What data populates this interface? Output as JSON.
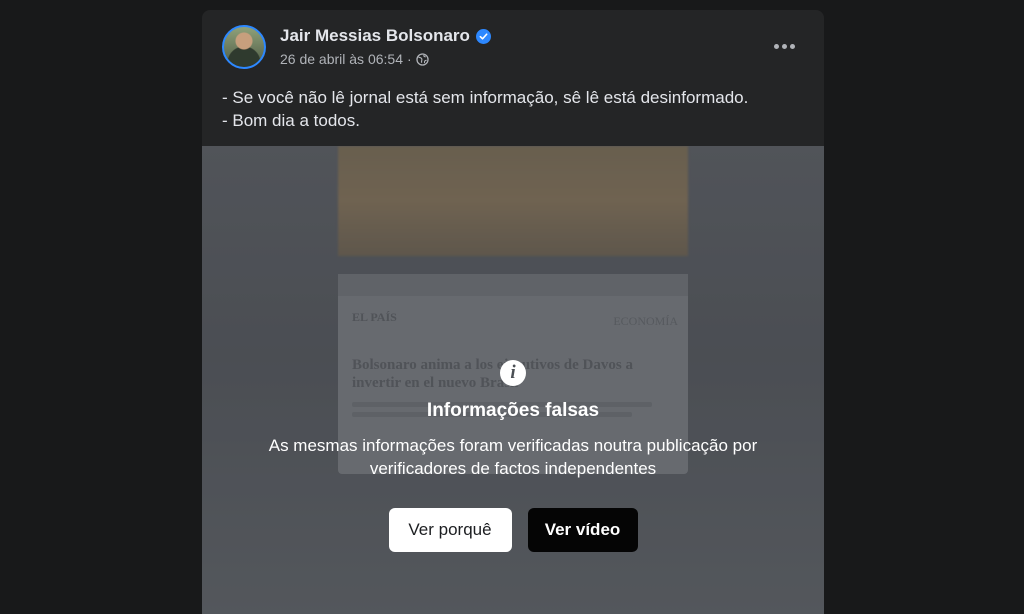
{
  "post": {
    "author": {
      "name": "Jair Messias Bolsonaro",
      "verified": true
    },
    "meta": {
      "timestamp": "26 de abril às 06:54",
      "separator": "·",
      "audience_icon": "globe-icon"
    },
    "more_icon": "more-horizontal-icon",
    "text_lines": [
      "- Se você não lê jornal está sem informação, sê lê está desinformado.",
      "- Bom dia a todos."
    ]
  },
  "media": {
    "article": {
      "logo": "EL PAÍS",
      "section": "ECONOMÍA",
      "headline": "Bolsonaro anima a los ejecutivos de Davos a invertir en el nuevo Brasil"
    },
    "warning": {
      "icon": "info-icon",
      "title": "Informações falsas",
      "description": "As mesmas informações foram verificadas noutra publicação por verificadores de factos independentes",
      "see_why_label": "Ver porquê",
      "see_video_label": "Ver vídeo"
    }
  },
  "colors": {
    "page_background": "#18191a",
    "card_background": "#242526",
    "verified_blue": "#2d88ff",
    "primary_text": "#e4e6eb",
    "secondary_text": "#b0b3b8"
  }
}
